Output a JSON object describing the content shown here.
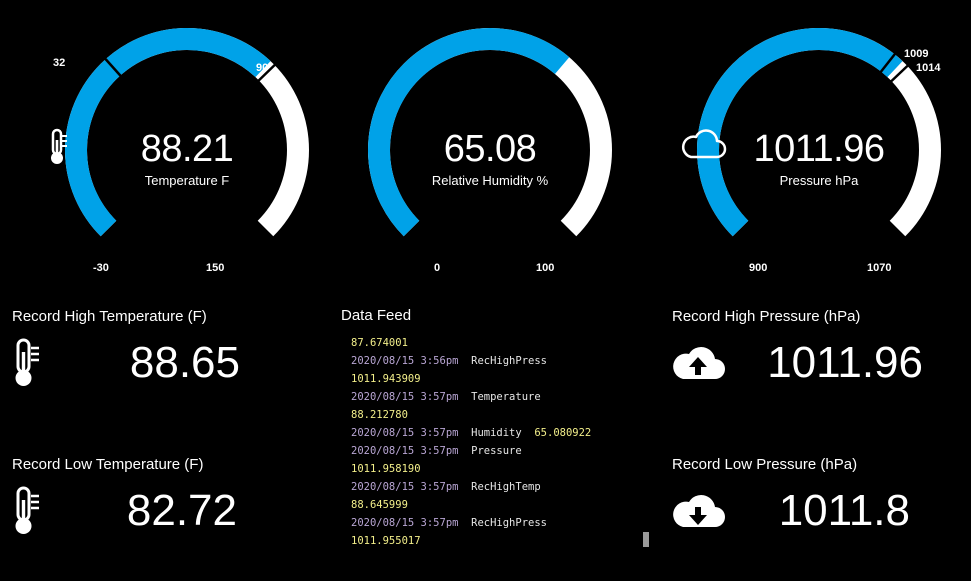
{
  "gauges": [
    {
      "id": "temperature",
      "value": "88.21",
      "label": "Temperature F",
      "icon": "thermometer-icon",
      "min_label": "-30",
      "max_label": "150",
      "markers": [
        "32",
        "90"
      ],
      "level_fraction": 0.66
    },
    {
      "id": "humidity",
      "value": "65.08",
      "label": "Relative Humidity %",
      "icon": "",
      "min_label": "0",
      "max_label": "100",
      "markers": [],
      "level_fraction": 0.65
    },
    {
      "id": "pressure",
      "value": "1011.96",
      "label": "Pressure hPa",
      "icon": "cloud-icon",
      "min_label": "900",
      "max_label": "1070",
      "markers": [
        "1009",
        "1014"
      ],
      "level_fraction": 0.66
    }
  ],
  "tiles": {
    "record_high_temp": {
      "title": "Record High Temperature (F)",
      "value": "88.65",
      "icon": "thermometer-icon"
    },
    "record_low_temp": {
      "title": "Record Low Temperature (F)",
      "value": "82.72",
      "icon": "thermometer-icon"
    },
    "record_high_pressure": {
      "title": "Record High Pressure (hPa)",
      "value": "1011.96",
      "icon": "cloud-upload-icon"
    },
    "record_low_pressure": {
      "title": "Record Low Pressure (hPa)",
      "value": "1011.8",
      "icon": "cloud-download-icon"
    }
  },
  "feed": {
    "title": "Data Feed",
    "rows": [
      {
        "ts": "",
        "topic": "",
        "value": "87.674001"
      },
      {
        "ts": "2020/08/15 3:56pm",
        "topic": "RecHighPress",
        "value": ""
      },
      {
        "ts": "",
        "topic": "",
        "value": "1011.943909"
      },
      {
        "ts": "2020/08/15 3:57pm",
        "topic": "Temperature",
        "value": ""
      },
      {
        "ts": "",
        "topic": "",
        "value": "88.212780"
      },
      {
        "ts": "2020/08/15 3:57pm",
        "topic": "Humidity",
        "value": "65.080922"
      },
      {
        "ts": "2020/08/15 3:57pm",
        "topic": "Pressure",
        "value": ""
      },
      {
        "ts": "",
        "topic": "",
        "value": "1011.958190"
      },
      {
        "ts": "2020/08/15 3:57pm",
        "topic": "RecHighTemp",
        "value": ""
      },
      {
        "ts": "",
        "topic": "",
        "value": "88.645999"
      },
      {
        "ts": "2020/08/15 3:57pm",
        "topic": "RecHighPress",
        "value": ""
      },
      {
        "ts": "",
        "topic": "",
        "value": "1011.955017"
      }
    ]
  },
  "colors": {
    "accent": "#00a2e8",
    "track": "#ffffff",
    "background": "#000000",
    "feed_timestamp": "#b9a6d4",
    "feed_value": "#f2ee8a"
  }
}
